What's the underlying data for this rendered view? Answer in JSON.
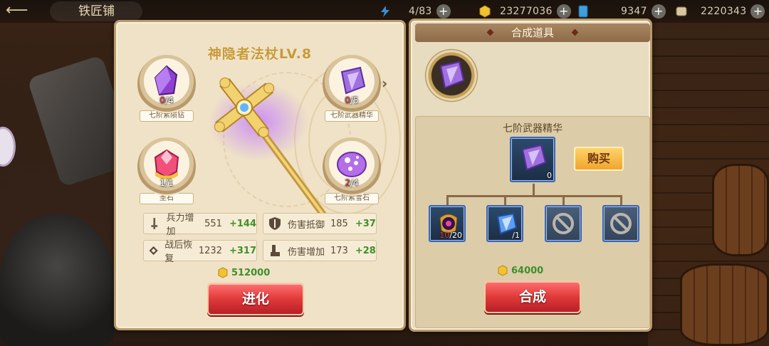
{
  "topbar": {
    "title": "铁匠铺",
    "resources": [
      {
        "name": "stamina",
        "value": "4/83",
        "color": "#3a8fd8"
      },
      {
        "name": "gold",
        "value": "23277036",
        "color": "#f2c230"
      },
      {
        "name": "blue-card",
        "value": "9347",
        "color": "#3fa0e0"
      },
      {
        "name": "scroll",
        "value": "2220343",
        "color": "#d8c7a0"
      }
    ]
  },
  "weapon": {
    "title": "神隐者法杖LV.8",
    "materials": [
      {
        "label": "七阶紫陨钻",
        "have": "0",
        "need": "/4",
        "gem_color": "#8e3fd0",
        "icon": "purple-crystal-icon"
      },
      {
        "label": "七阶武器精华",
        "have": "0",
        "need": "/5",
        "gem_color": "#a070e0",
        "icon": "essence-crystal-icon"
      },
      {
        "label": "圣石",
        "have": "",
        "need": "1/1",
        "gem_color": "#f0507a",
        "icon": "holy-stone-icon"
      },
      {
        "label": "七阶紫雪石",
        "have": "2",
        "need": "/4",
        "gem_color": "#b36ee8",
        "icon": "snow-stone-icon"
      }
    ],
    "stats": [
      {
        "name": "兵力增加",
        "value": "551",
        "plus": "+144",
        "icon": "sword-icon"
      },
      {
        "name": "伤害抵御",
        "value": "185",
        "plus": "+37",
        "icon": "shield-icon"
      },
      {
        "name": "战后恢复",
        "value": "1232",
        "plus": "+317",
        "icon": "heal-icon"
      },
      {
        "name": "伤害增加",
        "value": "173",
        "plus": "+28",
        "icon": "boot-icon"
      }
    ],
    "cost": "512000",
    "evolve_label": "进化"
  },
  "craft": {
    "header": "合成道具",
    "item_name": "七阶武器精华",
    "item_count": "0",
    "buy_label": "购买",
    "ingredients": [
      {
        "type": "gem",
        "have": "10",
        "need": "/20",
        "icon": "dark-orb-icon"
      },
      {
        "type": "gem",
        "have": "",
        "need": "/1",
        "icon": "blue-crystal-icon"
      },
      {
        "type": "empty",
        "icon": "forbidden-icon"
      },
      {
        "type": "empty",
        "icon": "forbidden-icon"
      }
    ],
    "cost": "64000",
    "craft_label": "合成"
  }
}
